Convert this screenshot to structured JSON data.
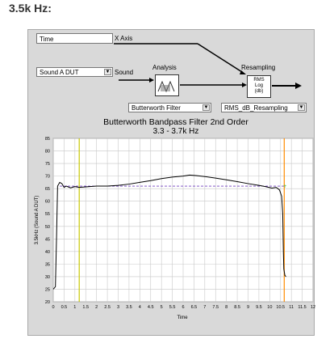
{
  "heading": "3.5k Hz:",
  "diagram": {
    "time_field": "Time",
    "x_axis_label": "X Axis",
    "input_field": "Sound A DUT",
    "sound_label": "Sound",
    "analysis_label": "Analysis",
    "resampling_label": "Resampling",
    "resampling_block": [
      "RMS",
      "Log",
      "(db)"
    ],
    "filter_select": "Butterworth Filter",
    "resampling_select": "RMS_dB_Resampling"
  },
  "chart_data": {
    "type": "line",
    "title": "Butterworth Bandpass Filter 2nd Order",
    "subtitle": "3.3 - 3.7k Hz",
    "xlabel": "Time",
    "ylabel": "3.5kHz (Sound A DUT)",
    "xlim": [
      0,
      12
    ],
    "ylim": [
      20,
      85
    ],
    "xticks": [
      "0",
      "0.5",
      "1",
      "1.5",
      "2",
      "2.5",
      "3",
      "3.5",
      "4",
      "4.5",
      "5",
      "5.5",
      "6",
      "6.5",
      "7",
      "7.5",
      "8",
      "8.5",
      "9",
      "9.5",
      "10",
      "10.5",
      "11",
      "11.5",
      "12"
    ],
    "yticks": [
      "20",
      "25",
      "30",
      "35",
      "40",
      "45",
      "50",
      "55",
      "60",
      "65",
      "70",
      "75",
      "80",
      "85"
    ],
    "grid": true,
    "markers": [
      {
        "x": 1.2,
        "color": "#c8c800"
      },
      {
        "x": 10.67,
        "color": "#ff8c00"
      }
    ],
    "reference_line": {
      "y": 66,
      "x_start": 0.3,
      "x_end": 10.7,
      "color": "#7040c0"
    },
    "series": [
      {
        "color": "#000000",
        "x": [
          0,
          0.05,
          0.1,
          0.15,
          0.2,
          0.3,
          0.4,
          0.5,
          0.6,
          0.8,
          1.0,
          1.2,
          1.5,
          2.0,
          2.5,
          3.0,
          3.5,
          4.0,
          4.5,
          5.0,
          5.5,
          6.0,
          6.3,
          6.6,
          7.0,
          7.5,
          8.0,
          8.5,
          9.0,
          9.5,
          9.8,
          10.1,
          10.3,
          10.45,
          10.55,
          10.6,
          10.63,
          10.65,
          10.7,
          10.75
        ],
        "y": [
          25,
          25.5,
          26,
          45,
          66,
          67.5,
          67,
          65.5,
          66,
          65.3,
          65.8,
          65.5,
          65.7,
          66,
          66,
          66.3,
          66.8,
          67.5,
          68.2,
          69,
          69.6,
          70,
          70.4,
          70.2,
          69.8,
          69.2,
          68.5,
          67.8,
          67,
          66.3,
          65.8,
          65.2,
          65.5,
          64.5,
          62,
          55,
          40,
          33,
          30.5,
          30
        ]
      }
    ]
  }
}
